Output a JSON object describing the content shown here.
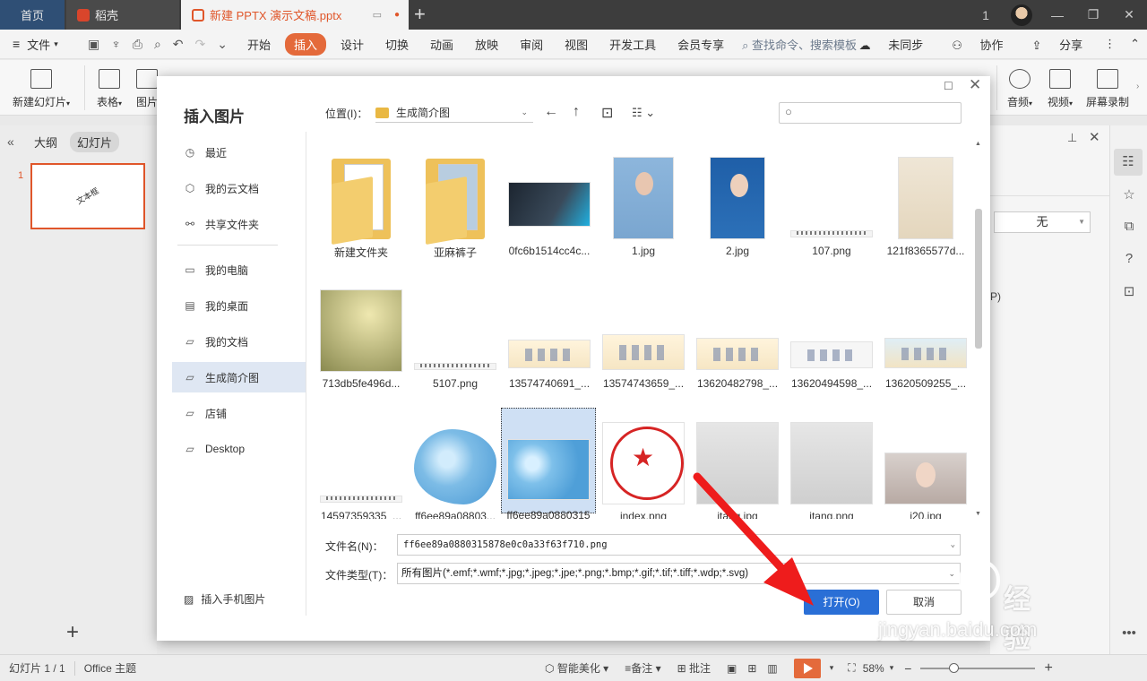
{
  "tabs": {
    "home": "首页",
    "daoke": "稻壳",
    "doc": "新建 PPTX 演示文稿.pptx",
    "badge": "1"
  },
  "menubar": {
    "file": "文件",
    "items": [
      "开始",
      "插入",
      "设计",
      "切换",
      "动画",
      "放映",
      "审阅",
      "视图",
      "开发工具",
      "会员专享"
    ],
    "active": "插入",
    "search": "查找命令、搜索模板",
    "unsynced": "未同步",
    "collab": "协作",
    "share": "分享"
  },
  "ribbon": {
    "new_slide": "新建幻灯片",
    "table": "表格",
    "picture": "图片",
    "audio": "音频",
    "video": "视频",
    "record": "屏幕录制"
  },
  "left_panel": {
    "tab_outline": "大纲",
    "tab_slides": "幻灯片",
    "slide_number": "1",
    "thumb_text": "文本框"
  },
  "right_panel": {
    "select_value": "无",
    "p_label": "P)"
  },
  "dialog": {
    "title": "插入图片",
    "location_label": "位置(I)：",
    "location_value": "生成简介图",
    "places": [
      {
        "label": "最近",
        "icon": "clock-icon"
      },
      {
        "label": "我的云文档",
        "icon": "cloud-box-icon"
      },
      {
        "label": "共享文件夹",
        "icon": "share-icon"
      },
      {
        "label": "我的电脑",
        "icon": "monitor-icon"
      },
      {
        "label": "我的桌面",
        "icon": "desktop-icon"
      },
      {
        "label": "我的文档",
        "icon": "folder-icon"
      },
      {
        "label": "生成简介图",
        "icon": "folder-icon"
      },
      {
        "label": "店铺",
        "icon": "folder-icon"
      },
      {
        "label": "Desktop",
        "icon": "folder-icon"
      }
    ],
    "active_place": "生成简介图",
    "phone_pic": "插入手机图片",
    "files": [
      {
        "name": "新建文件夹"
      },
      {
        "name": "亚麻裤子"
      },
      {
        "name": "0fc6b1514cc4c..."
      },
      {
        "name": "1.jpg"
      },
      {
        "name": "2.jpg"
      },
      {
        "name": "107.png"
      },
      {
        "name": "121f8365577d..."
      },
      {
        "name": "713db5fe496d..."
      },
      {
        "name": "5107.png"
      },
      {
        "name": "13574740691_..."
      },
      {
        "name": "13574743659_..."
      },
      {
        "name": "13620482798_..."
      },
      {
        "name": "13620494598_..."
      },
      {
        "name": "13620509255_..."
      },
      {
        "name": "14597359335_..."
      },
      {
        "name": "ff6ee89a08803..."
      },
      {
        "name": "ff6ee89a0880315"
      },
      {
        "name": "index.png"
      },
      {
        "name": "itang.jpg"
      },
      {
        "name": "itang.png"
      },
      {
        "name": "j20.jpg"
      }
    ],
    "selected_file": "ff6ee89a0880315",
    "filename_label": "文件名(N)：",
    "filename_value": "ff6ee89a0880315878e0c0a33f63f710.png",
    "filetype_label": "文件类型(T)：",
    "filetype_value": "所有图片(*.emf;*.wmf;*.jpg;*.jpeg;*.jpe;*.png;*.bmp;*.gif;*.tif;*.tiff;*.wdp;*.svg)",
    "open_button": "打开(O)",
    "cancel_button": "取消"
  },
  "statusbar": {
    "slide_info": "幻灯片 1 / 1",
    "theme": "Office 主题",
    "smart": "智能美化",
    "notes": "备注",
    "comment": "批注",
    "zoom": "58%"
  },
  "watermark": {
    "cn": "经验",
    "en": "jingyan.baidu.com"
  },
  "colors": {
    "accent": "#e46a3b",
    "primary_button": "#2a6fd6",
    "arrow": "#ee1c1c"
  }
}
